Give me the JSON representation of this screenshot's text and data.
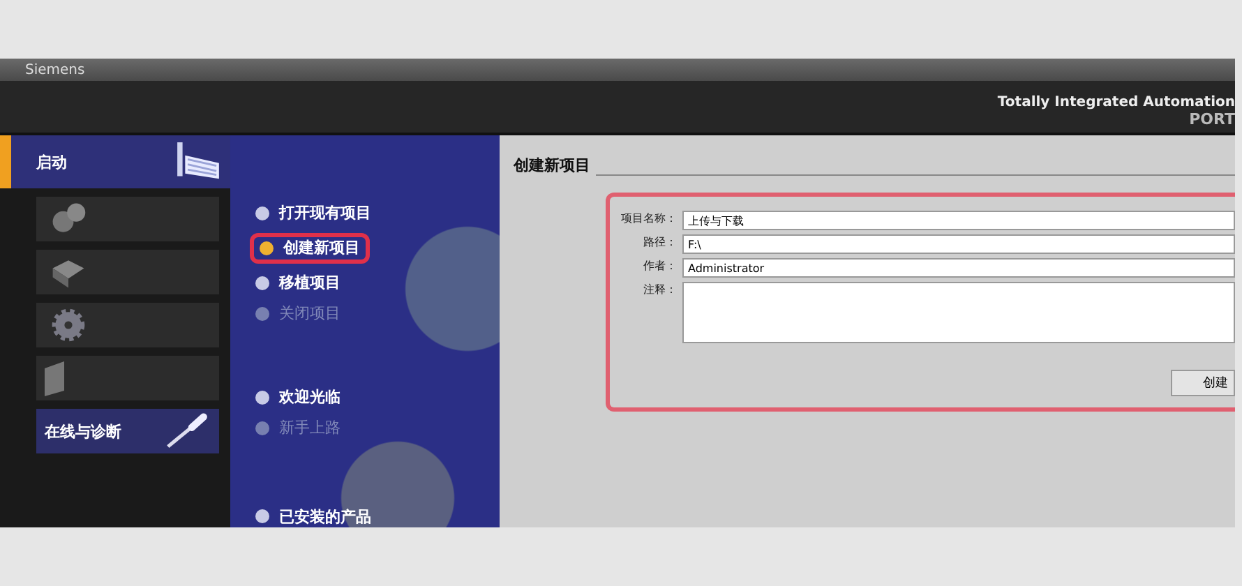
{
  "window": {
    "title": "Siemens"
  },
  "header": {
    "product": "Totally Integrated Automation",
    "edition": "PORT"
  },
  "sidebar": {
    "items": [
      {
        "label": "启动",
        "selected": true
      },
      {
        "selected": false
      },
      {
        "selected": false
      },
      {
        "selected": false
      },
      {
        "selected": false
      },
      {
        "label": "在线与诊断",
        "selected": false
      }
    ]
  },
  "menu": {
    "items": [
      {
        "label": "打开现有项目",
        "selected": false,
        "disabled": false
      },
      {
        "label": "创建新项目",
        "selected": true,
        "disabled": false
      },
      {
        "label": "移植项目",
        "selected": false,
        "disabled": false
      },
      {
        "label": "关闭项目",
        "selected": false,
        "disabled": true
      },
      {
        "label": "欢迎光临",
        "selected": false,
        "disabled": false
      },
      {
        "label": "新手上路",
        "selected": false,
        "disabled": true
      },
      {
        "label": "已安装的产品",
        "selected": false,
        "disabled": false
      }
    ]
  },
  "panel": {
    "title": "创建新项目",
    "fields": [
      {
        "label": "项目名称：",
        "value": "上传与下载",
        "kind": "line"
      },
      {
        "label": "路径：",
        "value": "F:\\",
        "kind": "line"
      },
      {
        "label": "作者：",
        "value": "Administrator",
        "kind": "line"
      },
      {
        "label": "注释：",
        "kind": "area"
      }
    ],
    "button": "创建"
  }
}
